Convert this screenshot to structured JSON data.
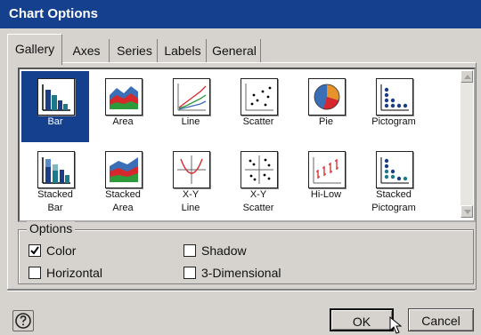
{
  "window": {
    "title": "Chart Options"
  },
  "tabs": [
    {
      "label": "Gallery",
      "active": true
    },
    {
      "label": "Axes"
    },
    {
      "label": "Series"
    },
    {
      "label": "Labels"
    },
    {
      "label": "General"
    }
  ],
  "gallery": {
    "row1": [
      {
        "label": "Bar",
        "icon": "bar-chart-icon",
        "selected": true
      },
      {
        "label": "Area",
        "icon": "area-chart-icon"
      },
      {
        "label": "Line",
        "icon": "line-chart-icon"
      },
      {
        "label": "Scatter",
        "icon": "scatter-chart-icon"
      },
      {
        "label": "Pie",
        "icon": "pie-chart-icon"
      },
      {
        "label": "Pictogram",
        "icon": "pictogram-chart-icon"
      }
    ],
    "row2": [
      {
        "line1": "Stacked",
        "line2": "Bar",
        "icon": "stacked-bar-chart-icon"
      },
      {
        "line1": "Stacked",
        "line2": "Area",
        "icon": "stacked-area-chart-icon"
      },
      {
        "line1": "X-Y",
        "line2": "Line",
        "icon": "xy-line-chart-icon"
      },
      {
        "line1": "X-Y",
        "line2": "Scatter",
        "icon": "xy-scatter-chart-icon"
      },
      {
        "line1": "Hi-Low",
        "line2": "",
        "icon": "hi-low-chart-icon"
      },
      {
        "line1": "Stacked",
        "line2": "Pictogram",
        "icon": "stacked-pictogram-chart-icon"
      }
    ]
  },
  "options": {
    "title": "Options",
    "color": {
      "label": "Color",
      "checked": true
    },
    "shadow": {
      "label": "Shadow",
      "checked": false
    },
    "horizontal": {
      "label": "Horizontal",
      "checked": false
    },
    "three_d": {
      "label": "3-Dimensional",
      "checked": false
    }
  },
  "buttons": {
    "ok": "OK",
    "cancel": "Cancel"
  },
  "colors": {
    "titlebar": "#15408e",
    "selection": "#15408e",
    "dialog": "#d6d3ce"
  }
}
